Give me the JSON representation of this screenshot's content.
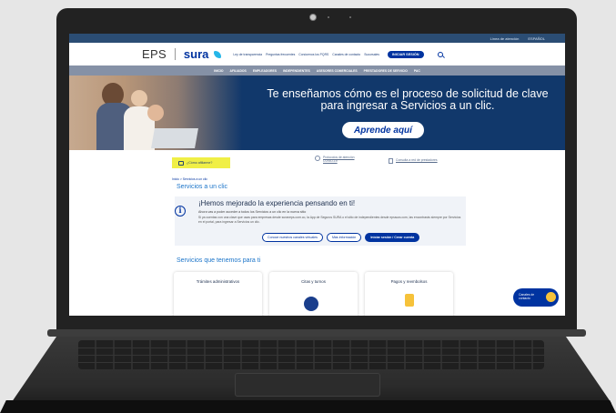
{
  "topbar": {
    "left": "Línea de atención",
    "right": "ESPAÑOL"
  },
  "brand": {
    "eps": "EPS",
    "sura": "sura"
  },
  "header_nav": [
    "Ley de transparencia",
    "Preguntas frecuentes",
    "Conócenos los PQRS",
    "Canales de contacto",
    "Sucursales"
  ],
  "login_label": "INICIAR SESIÓN",
  "main_nav": [
    "INICIO",
    "AFILIADOS",
    "EMPLEADORES",
    "INDEPENDIENTES",
    "ASESORES COMERCIALES",
    "PRESTADORES DE SERVICIO",
    "PAC"
  ],
  "hero": {
    "headline": "Te enseñamos cómo es el proceso de solicitud de clave para ingresar a Servicios a un clic.",
    "cta": "Aprende aquí"
  },
  "quick_links": {
    "afiliarme": "¿Cómo afiliarme?",
    "covid": "Protocolos de atención COVID-19",
    "consultas": "Consulta a red de prestadores"
  },
  "breadcrumb": "Inicio > Servicios a un clic",
  "section_title": "Servicios a un clic",
  "notice": {
    "title": "¡Hemos mejorado la experiencia pensando en ti!",
    "line1": "Ahora vas a poder acceder a todos los Servicios a un clic en la nueva sitio",
    "line2": "Si ya cuentas con una clave que usas para empresas desde suraneps.com.co, la App de Seguros SURA o el sitio de independientes desde epssura.com, las encontrarás siempre por Servicios en el portal, para ingresar a Servicios un clic.",
    "btn_outline1": "Conoce nuestros canales virtuales",
    "btn_outline2": "Más información",
    "btn_fill": "Iniciar sesión / Crear cuenta"
  },
  "services_title": "Servicios que tenemos para ti",
  "cards": [
    "Trámites administrativos",
    "Citas y turnos",
    "Pagos y reembolsos"
  ],
  "chat": {
    "line1": "Canales de",
    "line2": "contacto"
  }
}
